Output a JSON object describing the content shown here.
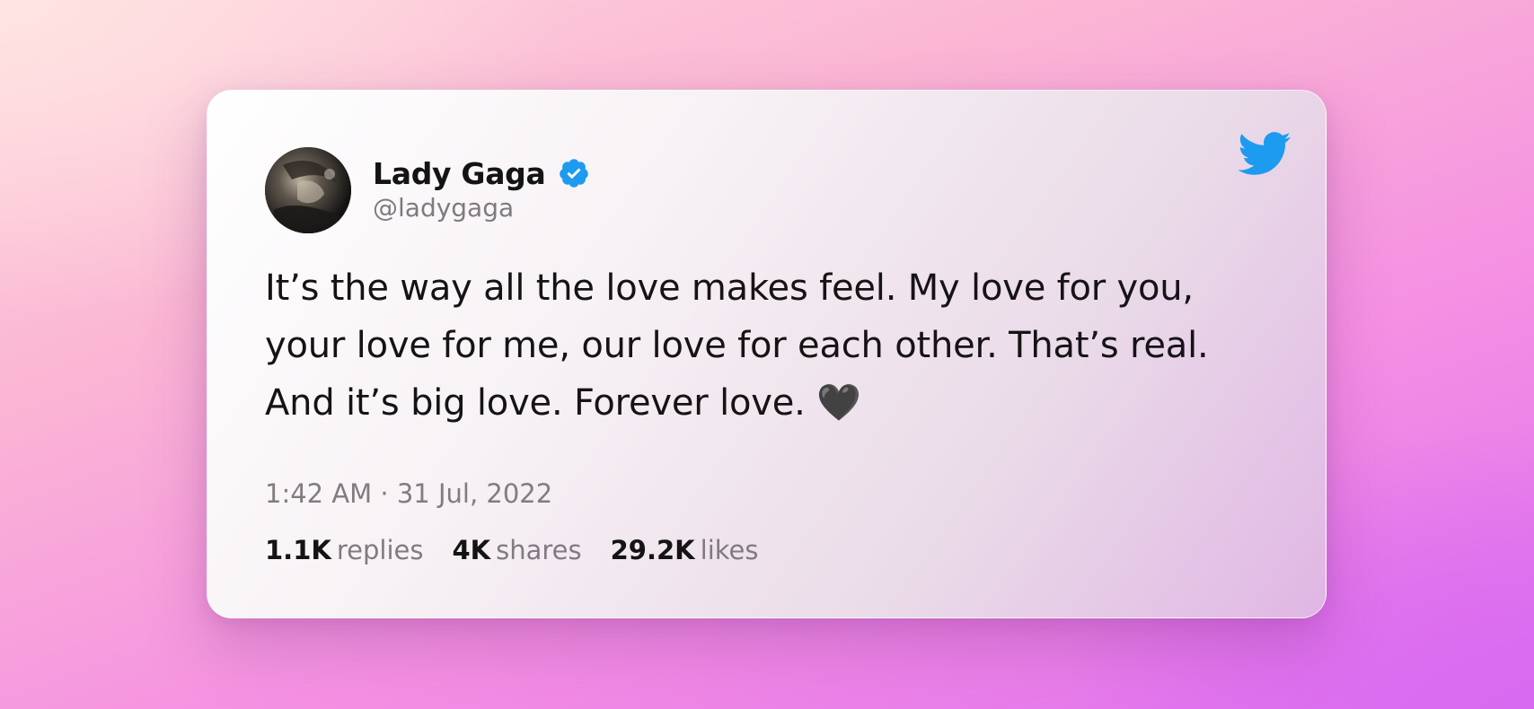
{
  "tweet": {
    "author": {
      "display_name": "Lady Gaga",
      "handle": "@ladygaga",
      "verified_icon": "verified-badge-icon",
      "avatar_icon": "profile-photo"
    },
    "brand_icon": "twitter-bird-icon",
    "text": "It’s the way all the love makes feel. My love for you, your love for me, our love for each other. That’s real. And it’s big love. Forever love. 🖤",
    "timestamp": "1:42 AM · 31 Jul, 2022",
    "stats": {
      "replies": {
        "count": "1.1K",
        "label": "replies"
      },
      "shares": {
        "count": "4K",
        "label": "shares"
      },
      "likes": {
        "count": "29.2K",
        "label": "likes"
      }
    }
  },
  "colors": {
    "twitter_blue": "#1d9bf0",
    "text_primary": "#141414",
    "text_secondary": "#807a82"
  }
}
